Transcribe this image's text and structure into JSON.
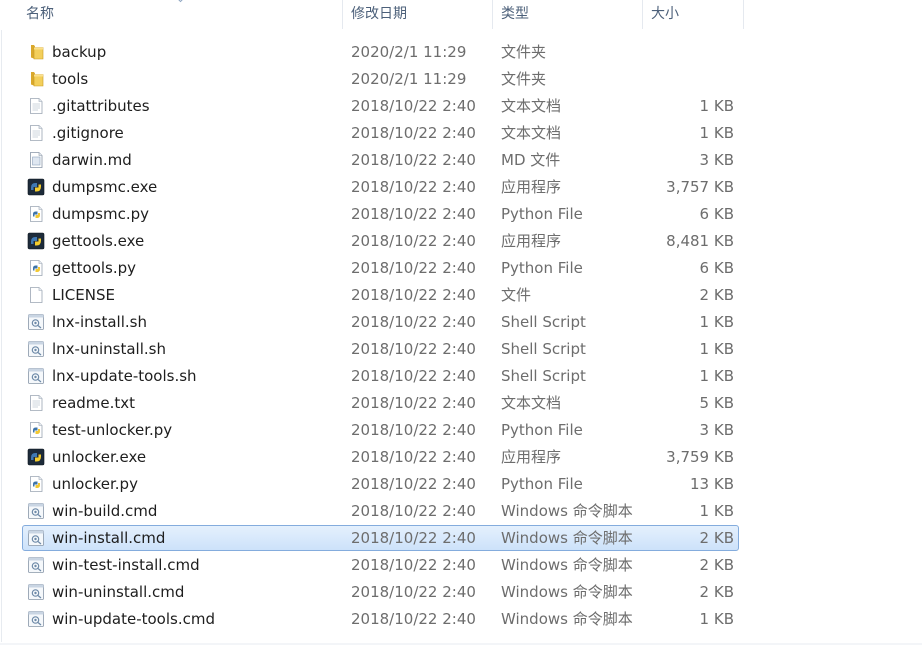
{
  "columns": {
    "name": "名称",
    "date": "修改日期",
    "type": "类型",
    "size": "大小"
  },
  "files": [
    {
      "name": "backup",
      "date": "2020/2/1 11:29",
      "type": "文件夹",
      "size": "",
      "icon": "folder-icon"
    },
    {
      "name": "tools",
      "date": "2020/2/1 11:29",
      "type": "文件夹",
      "size": "",
      "icon": "folder-icon"
    },
    {
      "name": ".gitattributes",
      "date": "2018/10/22 2:40",
      "type": "文本文档",
      "size": "1 KB",
      "icon": "text-file-icon"
    },
    {
      "name": ".gitignore",
      "date": "2018/10/22 2:40",
      "type": "文本文档",
      "size": "1 KB",
      "icon": "text-file-icon"
    },
    {
      "name": "darwin.md",
      "date": "2018/10/22 2:40",
      "type": "MD 文件",
      "size": "3 KB",
      "icon": "md-file-icon"
    },
    {
      "name": "dumpsmc.exe",
      "date": "2018/10/22 2:40",
      "type": "应用程序",
      "size": "3,757 KB",
      "icon": "python-exe-icon"
    },
    {
      "name": "dumpsmc.py",
      "date": "2018/10/22 2:40",
      "type": "Python File",
      "size": "6 KB",
      "icon": "python-file-icon"
    },
    {
      "name": "gettools.exe",
      "date": "2018/10/22 2:40",
      "type": "应用程序",
      "size": "8,481 KB",
      "icon": "python-exe-icon"
    },
    {
      "name": "gettools.py",
      "date": "2018/10/22 2:40",
      "type": "Python File",
      "size": "6 KB",
      "icon": "python-file-icon"
    },
    {
      "name": "LICENSE",
      "date": "2018/10/22 2:40",
      "type": "文件",
      "size": "2 KB",
      "icon": "blank-file-icon"
    },
    {
      "name": "lnx-install.sh",
      "date": "2018/10/22 2:40",
      "type": "Shell Script",
      "size": "1 KB",
      "icon": "script-file-icon"
    },
    {
      "name": "lnx-uninstall.sh",
      "date": "2018/10/22 2:40",
      "type": "Shell Script",
      "size": "1 KB",
      "icon": "script-file-icon"
    },
    {
      "name": "lnx-update-tools.sh",
      "date": "2018/10/22 2:40",
      "type": "Shell Script",
      "size": "1 KB",
      "icon": "script-file-icon"
    },
    {
      "name": "readme.txt",
      "date": "2018/10/22 2:40",
      "type": "文本文档",
      "size": "5 KB",
      "icon": "text-file-icon"
    },
    {
      "name": "test-unlocker.py",
      "date": "2018/10/22 2:40",
      "type": "Python File",
      "size": "3 KB",
      "icon": "python-file-icon"
    },
    {
      "name": "unlocker.exe",
      "date": "2018/10/22 2:40",
      "type": "应用程序",
      "size": "3,759 KB",
      "icon": "python-exe-icon"
    },
    {
      "name": "unlocker.py",
      "date": "2018/10/22 2:40",
      "type": "Python File",
      "size": "13 KB",
      "icon": "python-file-icon"
    },
    {
      "name": "win-build.cmd",
      "date": "2018/10/22 2:40",
      "type": "Windows 命令脚本",
      "size": "1 KB",
      "icon": "script-file-icon"
    },
    {
      "name": "win-install.cmd",
      "date": "2018/10/22 2:40",
      "type": "Windows 命令脚本",
      "size": "2 KB",
      "icon": "script-file-icon",
      "selected": true
    },
    {
      "name": "win-test-install.cmd",
      "date": "2018/10/22 2:40",
      "type": "Windows 命令脚本",
      "size": "2 KB",
      "icon": "script-file-icon"
    },
    {
      "name": "win-uninstall.cmd",
      "date": "2018/10/22 2:40",
      "type": "Windows 命令脚本",
      "size": "2 KB",
      "icon": "script-file-icon"
    },
    {
      "name": "win-update-tools.cmd",
      "date": "2018/10/22 2:40",
      "type": "Windows 命令脚本",
      "size": "1 KB",
      "icon": "script-file-icon"
    }
  ],
  "colors": {
    "selection_fill": "#cde2fa",
    "selection_border": "#84acdd",
    "header_text": "#4c607a",
    "name_text": "#1e1e1e",
    "detail_text": "#6d6d6d"
  }
}
